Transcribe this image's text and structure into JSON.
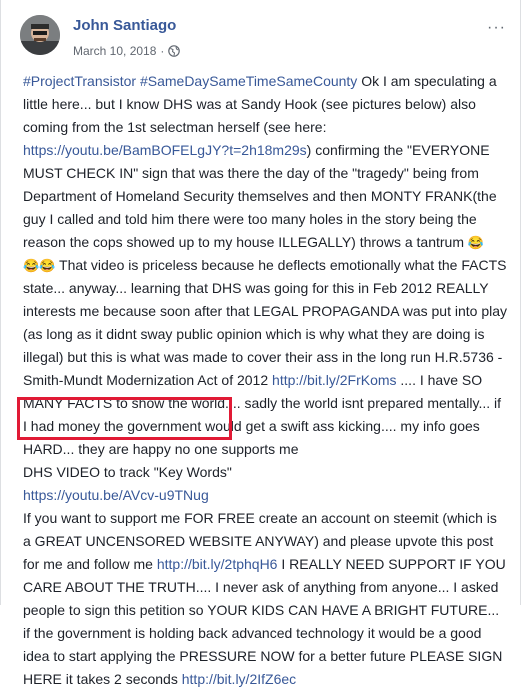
{
  "post": {
    "author": "John Santiago",
    "date": "March 10, 2018",
    "separator": "·",
    "more_label": "···",
    "emoji_laugh": "😂",
    "para1": {
      "tags": "#ProjectTransistor #SameDaySameTimeSameCounty",
      "t1": " Ok I am speculating a little here... but I know DHS was at Sandy Hook (see pictures below) also coming from the 1st selectman herself (see here: ",
      "link1": "https://youtu.be/BamBOFELgJY?t=2h18m29s",
      "t2": ") confirming the \"EVERYONE MUST CHECK IN\" sign that was there the day of the \"tragedy\" being from Department of Homeland Security themselves and then MONTY FRANK(the guy I called and told him there were too many holes in the story being the reason the cops showed up to my house ILLEGALLY) throws a tantrum ",
      "t3": " That video is priceless because he deflects emotionally what the FACTS state... anyway... learning that DHS was going for this in Feb 2012 REALLY interests me because soon after that LEGAL PROPAGANDA was put into play (as long as it didnt sway public opinion which is why what they are doing is illegal) but this is what was made to cover their ass in the long run H.R.5736 - Smith-Mundt Modernization Act of 2012 ",
      "link2": "http://bit.ly/2FrKoms",
      "t4": " .... I have SO MANY FACTS to show the world.... sadly the world isnt prepared mentally... if I had money the government would get a swift ass kicking.... my info goes HARD... they are happy no one supports me"
    },
    "para2": {
      "label": "DHS VIDEO to track \"Key Words\"",
      "link": "https://youtu.be/AVcv-u9TNug"
    },
    "para3": {
      "t1": "If you want to support me FOR FREE create an account on steemit (which is a GREAT UNCENSORED WEBSITE ANYWAY) and please upvote this post for me and follow me ",
      "link1": "http://bit.ly/2tphqH6",
      "t2": " I REALLY NEED SUPPORT IF YOU CARE ABOUT THE TRUTH.... I never ask of anything from anyone... I asked people to sign this petition so YOUR KIDS CAN HAVE A BRIGHT FUTURE... if the government is holding back advanced technology it would be a good idea to start applying the PRESSURE NOW for a better future PLEASE SIGN HERE it takes 2 seconds ",
      "link2": "http://bit.ly/2IfZ6ec"
    }
  },
  "colors": {
    "link": "#385898",
    "highlight_border": "#e11a35",
    "meta": "#616770"
  },
  "icons": {
    "privacy": "globe-icon",
    "menu": "more-options-icon"
  }
}
